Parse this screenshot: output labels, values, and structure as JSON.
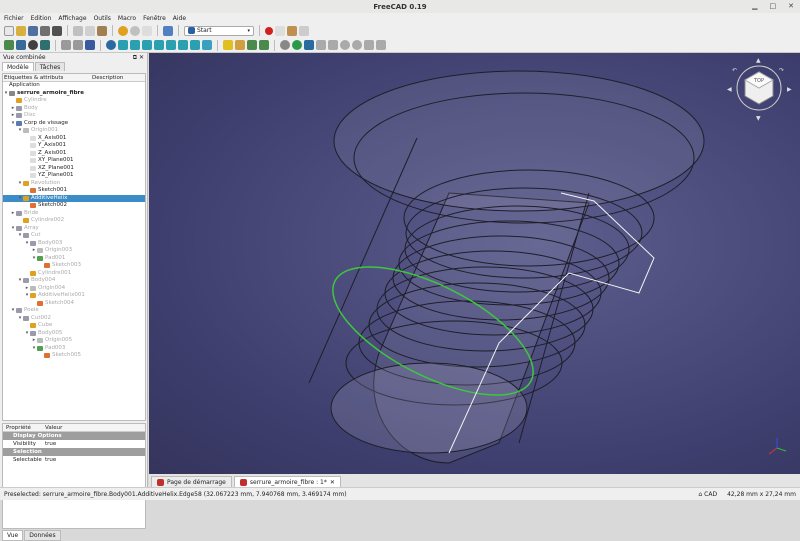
{
  "window": {
    "title": "FreeCAD 0.19"
  },
  "menu": [
    "Fichier",
    "Edition",
    "Affichage",
    "Outils",
    "Macro",
    "Fenêtre",
    "Aide"
  ],
  "toolbar": {
    "workbench": "Start"
  },
  "combo_view": {
    "title": "Vue combinée",
    "tabs": [
      "Modèle",
      "Tâches"
    ],
    "tree_headers": [
      "Etiquettes & attributs",
      "Description"
    ],
    "tree": [
      {
        "label": "Application",
        "level": 0,
        "arrow": "",
        "icon": "",
        "state": "normal"
      },
      {
        "label": "serrure_armoire_fibre",
        "level": 0,
        "arrow": "▾",
        "icon": "#888",
        "state": "bold"
      },
      {
        "label": "Cylindre",
        "level": 1,
        "arrow": "",
        "icon": "#e0a020",
        "state": "dim"
      },
      {
        "label": "Body",
        "level": 1,
        "arrow": "▸",
        "icon": "#9a9aaa",
        "state": "dim"
      },
      {
        "label": "Disc",
        "level": 1,
        "arrow": "▸",
        "icon": "#9a9aaa",
        "state": "dim"
      },
      {
        "label": "Corp de vissage",
        "level": 1,
        "arrow": "▾",
        "icon": "#5a7ab0",
        "state": "normal"
      },
      {
        "label": "Origin001",
        "level": 2,
        "arrow": "▾",
        "icon": "#bbbbbb",
        "state": "dim"
      },
      {
        "label": "X_Axis001",
        "level": 3,
        "arrow": "",
        "icon": "#dddddd",
        "state": "normal"
      },
      {
        "label": "Y_Axis001",
        "level": 3,
        "arrow": "",
        "icon": "#dddddd",
        "state": "normal"
      },
      {
        "label": "Z_Axis001",
        "level": 3,
        "arrow": "",
        "icon": "#dddddd",
        "state": "normal"
      },
      {
        "label": "XY_Plane001",
        "level": 3,
        "arrow": "",
        "icon": "#dddddd",
        "state": "normal"
      },
      {
        "label": "XZ_Plane001",
        "level": 3,
        "arrow": "",
        "icon": "#dddddd",
        "state": "normal"
      },
      {
        "label": "YZ_Plane001",
        "level": 3,
        "arrow": "",
        "icon": "#dddddd",
        "state": "normal"
      },
      {
        "label": "Revolution",
        "level": 2,
        "arrow": "▾",
        "icon": "#e0a020",
        "state": "dim"
      },
      {
        "label": "Sketch001",
        "level": 3,
        "arrow": "",
        "icon": "#e07030",
        "state": "normal"
      },
      {
        "label": "AdditiveHelix",
        "level": 2,
        "arrow": "▾",
        "icon": "#e0a020",
        "state": "sel"
      },
      {
        "label": "Sketch002",
        "level": 3,
        "arrow": "",
        "icon": "#e07030",
        "state": "normal"
      },
      {
        "label": "Bride",
        "level": 1,
        "arrow": "▸",
        "icon": "#9a9aaa",
        "state": "dim"
      },
      {
        "label": "Cylindre002",
        "level": 2,
        "arrow": "",
        "icon": "#e0a020",
        "state": "dim"
      },
      {
        "label": "Array",
        "level": 1,
        "arrow": "▾",
        "icon": "#9a9aaa",
        "state": "dim"
      },
      {
        "label": "Cut",
        "level": 2,
        "arrow": "▾",
        "icon": "#9a9aaa",
        "state": "dim"
      },
      {
        "label": "Body003",
        "level": 3,
        "arrow": "▾",
        "icon": "#9a9aaa",
        "state": "dim"
      },
      {
        "label": "Origin003",
        "level": 4,
        "arrow": "▸",
        "icon": "#bbbbbb",
        "state": "dim"
      },
      {
        "label": "Pad001",
        "level": 4,
        "arrow": "▾",
        "icon": "#50a050",
        "state": "dim"
      },
      {
        "label": "Sketch003",
        "level": 5,
        "arrow": "",
        "icon": "#e07030",
        "state": "dim"
      },
      {
        "label": "Cylindre001",
        "level": 3,
        "arrow": "",
        "icon": "#e0a020",
        "state": "dim"
      },
      {
        "label": "Body004",
        "level": 2,
        "arrow": "▾",
        "icon": "#9a9aaa",
        "state": "dim"
      },
      {
        "label": "Origin004",
        "level": 3,
        "arrow": "▸",
        "icon": "#bbbbbb",
        "state": "dim"
      },
      {
        "label": "AdditiveHelix001",
        "level": 3,
        "arrow": "▾",
        "icon": "#e0a020",
        "state": "dim"
      },
      {
        "label": "Sketch004",
        "level": 4,
        "arrow": "",
        "icon": "#e07030",
        "state": "dim"
      },
      {
        "label": "Poele",
        "level": 1,
        "arrow": "▾",
        "icon": "#9a9aaa",
        "state": "dim"
      },
      {
        "label": "Cut002",
        "level": 2,
        "arrow": "▾",
        "icon": "#9a9aaa",
        "state": "dim"
      },
      {
        "label": "Cube",
        "level": 3,
        "arrow": "",
        "icon": "#e0a020",
        "state": "dim"
      },
      {
        "label": "Body005",
        "level": 3,
        "arrow": "▾",
        "icon": "#9a9aaa",
        "state": "dim"
      },
      {
        "label": "Origin005",
        "level": 4,
        "arrow": "▸",
        "icon": "#bbbbbb",
        "state": "dim"
      },
      {
        "label": "Pad003",
        "level": 4,
        "arrow": "▾",
        "icon": "#50a050",
        "state": "dim"
      },
      {
        "label": "Sketch005",
        "level": 5,
        "arrow": "",
        "icon": "#e07030",
        "state": "dim"
      }
    ],
    "prop_headers": [
      "Propriété",
      "Valeur"
    ],
    "properties": [
      {
        "type": "group",
        "label": "Display Options"
      },
      {
        "type": "prop",
        "key": "Visibility",
        "value": "true"
      },
      {
        "type": "group",
        "label": "Selection"
      },
      {
        "type": "prop",
        "key": "Selectable",
        "value": "true"
      }
    ],
    "bottom_tabs": [
      "Vue",
      "Données"
    ]
  },
  "doc_tabs": [
    "Page de démarrage",
    "serrure_armoire_fibre : 1*"
  ],
  "statusbar": {
    "message": "Preselected: serrure_armoire_fibre.Body001.AdditiveHelix.Edge58 (32.067223 mm, 7.940768 mm, 3.469174 mm)",
    "nav": "CAD",
    "dims": "42,28 mm x 27,24 mm"
  },
  "navcube": {
    "face": "TOP"
  },
  "colors": {
    "selection": "#3c8cc8",
    "viewport": "#4a4a7a",
    "highlight": "#3cc83c"
  }
}
